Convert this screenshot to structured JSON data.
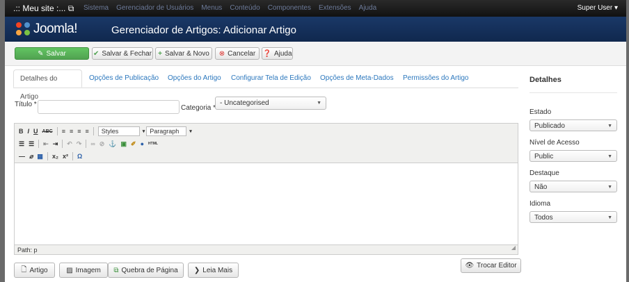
{
  "topbar": {
    "site": ".:: Meu site :... ",
    "site_icon": "external-link-icon",
    "menu": [
      "Sistema",
      "Gerenciador de Usuários",
      "Menus",
      "Conteúdo",
      "Componentes",
      "Extensões",
      "Ajuda"
    ],
    "user": "Super User"
  },
  "header": {
    "brand": "Joomla!",
    "title": "Gerenciador de Artigos: Adicionar Artigo"
  },
  "toolbar": {
    "save": "Salvar",
    "save_close": "Salvar & Fechar",
    "save_new": "Salvar & Novo",
    "cancel": "Cancelar",
    "help": "Ajuda"
  },
  "tabs": [
    "Detalhes do Artigo",
    "Opções de Publicação",
    "Opções do Artigo",
    "Configurar Tela de Edição",
    "Opções de Meta-Dados",
    "Permissões do Artigo"
  ],
  "form": {
    "title_label": "Título *",
    "title_value": "",
    "category_label": "Categoria *",
    "category_value": "- Uncategorised"
  },
  "editor": {
    "styles": "Styles",
    "paragraph": "Paragraph",
    "path": "Path: p"
  },
  "buttons": {
    "article": "Artigo",
    "image": "Imagem",
    "pagebreak": "Quebra de Página",
    "readmore": "Leia Mais",
    "toggle_editor": "Trocar Editor"
  },
  "sidebar": {
    "title": "Detalhes",
    "status_label": "Estado",
    "status_value": "Publicado",
    "access_label": "Nível de Acesso",
    "access_value": "Public",
    "featured_label": "Destaque",
    "featured_value": "Não",
    "language_label": "Idioma",
    "language_value": "Todos"
  },
  "colors": {
    "topbar": "#1d1d1d",
    "header": "#163566",
    "save_green": "#51a351",
    "link": "#2b77bd"
  }
}
